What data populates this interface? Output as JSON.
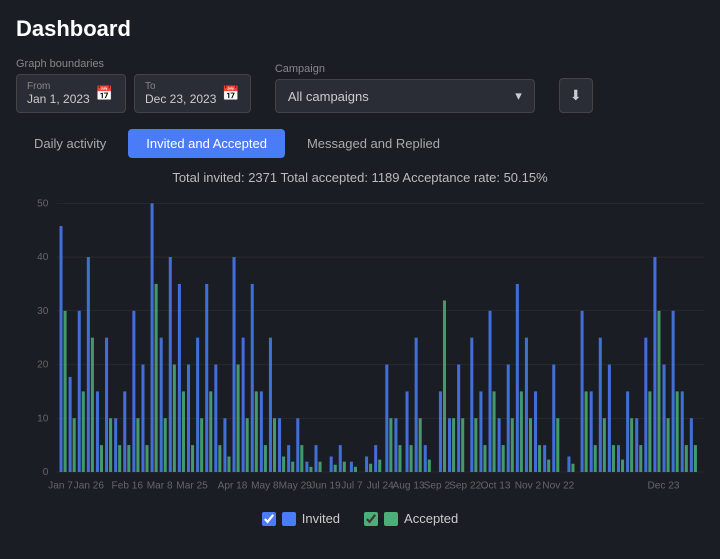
{
  "page": {
    "title": "Dashboard"
  },
  "controls": {
    "graph_boundaries_label": "Graph boundaries",
    "from_label": "From",
    "from_value": "Jan 1, 2023",
    "to_label": "To",
    "to_value": "Dec 23, 2023",
    "campaign_label": "Campaign",
    "campaign_value": "All campaigns",
    "download_icon": "⬇"
  },
  "tabs": [
    {
      "id": "daily",
      "label": "Daily activity",
      "active": false
    },
    {
      "id": "invited-accepted",
      "label": "Invited and Accepted",
      "active": true
    },
    {
      "id": "messaged-replied",
      "label": "Messaged and Replied",
      "active": false
    }
  ],
  "stats": {
    "text": "Total invited: 2371   Total accepted: 1189   Acceptance rate: 50.15%"
  },
  "chart": {
    "y_max": 50,
    "y_labels": [
      0,
      10,
      20,
      30,
      40,
      50
    ],
    "x_labels": [
      "Jan 7",
      "Jan 26",
      "Feb 16",
      "Mar 8",
      "Mar 25",
      "Apr 18",
      "May 8",
      "May 29",
      "Jun 19",
      "Jul 7",
      "Jul 24",
      "Aug 13",
      "Sep 2",
      "Sep 22",
      "Oct 13",
      "Nov 2",
      "Nov 22",
      "Dec 23"
    ]
  },
  "legend": {
    "invited_label": "Invited",
    "accepted_label": "Accepted",
    "invited_color": "#4a7cf7",
    "accepted_color": "#4caf78"
  }
}
